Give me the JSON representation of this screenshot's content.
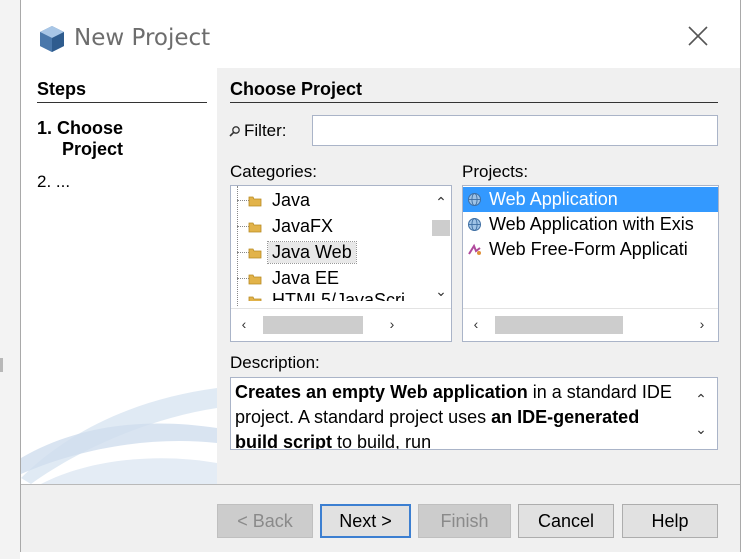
{
  "window": {
    "title": "New Project",
    "close_icon": "close-icon"
  },
  "steps": {
    "header": "Steps",
    "items": [
      {
        "number": "1.",
        "label_line1": "Choose",
        "label_line2": "Project"
      },
      {
        "number": "2.",
        "label": "..."
      }
    ]
  },
  "main": {
    "header": "Choose Project",
    "filter": {
      "label": "Filter:",
      "value": ""
    },
    "categories": {
      "label": "Categories:",
      "items": [
        "Java",
        "JavaFX",
        "Java Web",
        "Java EE",
        "HTML5/JavaScri"
      ],
      "selected": "Java Web"
    },
    "projects": {
      "label": "Projects:",
      "items": [
        {
          "label": "Web Application",
          "icon": "globe-icon"
        },
        {
          "label": "Web Application with Exis",
          "icon": "globe-icon"
        },
        {
          "label": "Web Free-Form Applicati",
          "icon": "freeform-icon"
        }
      ],
      "selected": "Web Application"
    },
    "description": {
      "label": "Description:",
      "bold1": "Creates an empty Web application",
      "text1": " in a standard IDE project. A standard project uses ",
      "bold2": "an IDE-generated build script",
      "text2": " to build, run"
    }
  },
  "buttons": {
    "back": "< Back",
    "next": "Next >",
    "finish": "Finish",
    "cancel": "Cancel",
    "help": "Help"
  },
  "colors": {
    "selection": "#3399ff",
    "dialog_bg": "#f0f0f0",
    "default_button_border": "#3c7fd1"
  }
}
